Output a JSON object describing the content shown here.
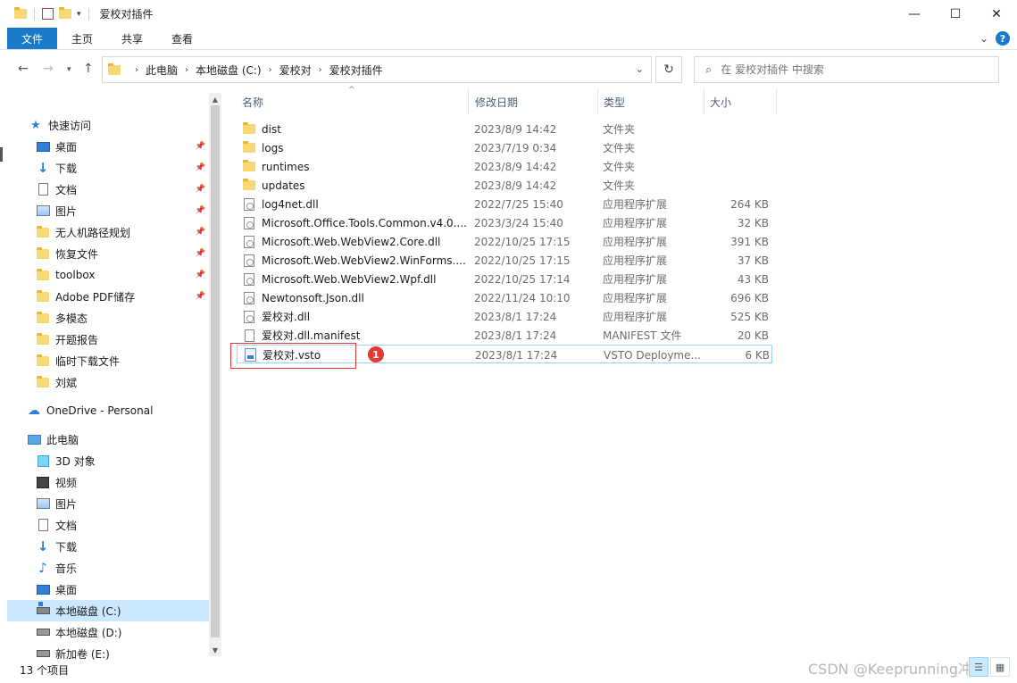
{
  "window": {
    "title": "爱校对插件",
    "controls": {
      "minimize": "—",
      "maximize": "☐",
      "close": "✕"
    }
  },
  "ribbon": {
    "tabs": [
      "文件",
      "主页",
      "共享",
      "查看"
    ],
    "expand": "⌄",
    "help": "?"
  },
  "address": {
    "crumbs": [
      "此电脑",
      "本地磁盘 (C:)",
      "爱校对",
      "爱校对插件"
    ],
    "search_placeholder": "在 爱校对插件 中搜索"
  },
  "nav": {
    "items": [
      {
        "label": "快速访问",
        "icon": "star-icon",
        "pinned": false,
        "selected": false
      },
      {
        "label": "桌面",
        "icon": "desktop-icon",
        "pinned": true,
        "selected": false
      },
      {
        "label": "下载",
        "icon": "download-icon",
        "pinned": true,
        "selected": false
      },
      {
        "label": "文档",
        "icon": "document-icon",
        "pinned": true,
        "selected": false
      },
      {
        "label": "图片",
        "icon": "picture-icon",
        "pinned": true,
        "selected": false
      },
      {
        "label": "无人机路径规划",
        "icon": "folder-icon",
        "pinned": true,
        "selected": false
      },
      {
        "label": "恢复文件",
        "icon": "folder-icon",
        "pinned": true,
        "selected": false
      },
      {
        "label": "toolbox",
        "icon": "folder-icon",
        "pinned": true,
        "selected": false
      },
      {
        "label": "Adobe PDF储存",
        "icon": "folder-icon",
        "pinned": true,
        "selected": false
      },
      {
        "label": "多模态",
        "icon": "folder-icon",
        "pinned": false,
        "selected": false
      },
      {
        "label": "开题报告",
        "icon": "folder-icon",
        "pinned": false,
        "selected": false
      },
      {
        "label": "临时下载文件",
        "icon": "folder-icon",
        "pinned": false,
        "selected": false
      },
      {
        "label": "刘斌",
        "icon": "folder-icon",
        "pinned": false,
        "selected": false
      },
      {
        "label": "OneDrive - Personal",
        "icon": "cloud-icon",
        "pinned": false,
        "selected": false
      },
      {
        "label": "此电脑",
        "icon": "computer-icon",
        "pinned": false,
        "selected": false
      },
      {
        "label": "3D 对象",
        "icon": "cube-icon",
        "pinned": false,
        "selected": false
      },
      {
        "label": "视频",
        "icon": "video-icon",
        "pinned": false,
        "selected": false
      },
      {
        "label": "图片",
        "icon": "picture-icon",
        "pinned": false,
        "selected": false
      },
      {
        "label": "文档",
        "icon": "document-icon",
        "pinned": false,
        "selected": false
      },
      {
        "label": "下载",
        "icon": "download-icon",
        "pinned": false,
        "selected": false
      },
      {
        "label": "音乐",
        "icon": "music-icon",
        "pinned": false,
        "selected": false
      },
      {
        "label": "桌面",
        "icon": "desktop-icon",
        "pinned": false,
        "selected": false
      },
      {
        "label": "本地磁盘 (C:)",
        "icon": "drive-c-icon",
        "pinned": false,
        "selected": true
      },
      {
        "label": "本地磁盘 (D:)",
        "icon": "drive-icon",
        "pinned": false,
        "selected": false
      },
      {
        "label": "新加卷 (E:)",
        "icon": "drive-icon",
        "pinned": false,
        "selected": false
      }
    ]
  },
  "columns": [
    "名称",
    "修改日期",
    "类型",
    "大小"
  ],
  "files": [
    {
      "name": "dist",
      "date": "2023/8/9 14:42",
      "type": "文件夹",
      "size": "",
      "icon": "folder"
    },
    {
      "name": "logs",
      "date": "2023/7/19 0:34",
      "type": "文件夹",
      "size": "",
      "icon": "folder"
    },
    {
      "name": "runtimes",
      "date": "2023/8/9 14:42",
      "type": "文件夹",
      "size": "",
      "icon": "folder"
    },
    {
      "name": "updates",
      "date": "2023/8/9 14:42",
      "type": "文件夹",
      "size": "",
      "icon": "folder"
    },
    {
      "name": "log4net.dll",
      "date": "2022/7/25 15:40",
      "type": "应用程序扩展",
      "size": "264 KB",
      "icon": "dll"
    },
    {
      "name": "Microsoft.Office.Tools.Common.v4.0....",
      "date": "2023/3/24 15:40",
      "type": "应用程序扩展",
      "size": "32 KB",
      "icon": "dll"
    },
    {
      "name": "Microsoft.Web.WebView2.Core.dll",
      "date": "2022/10/25 17:15",
      "type": "应用程序扩展",
      "size": "391 KB",
      "icon": "dll"
    },
    {
      "name": "Microsoft.Web.WebView2.WinForms....",
      "date": "2022/10/25 17:15",
      "type": "应用程序扩展",
      "size": "37 KB",
      "icon": "dll"
    },
    {
      "name": "Microsoft.Web.WebView2.Wpf.dll",
      "date": "2022/10/25 17:14",
      "type": "应用程序扩展",
      "size": "43 KB",
      "icon": "dll"
    },
    {
      "name": "Newtonsoft.Json.dll",
      "date": "2022/11/24 10:10",
      "type": "应用程序扩展",
      "size": "696 KB",
      "icon": "dll"
    },
    {
      "name": "爱校对.dll",
      "date": "2023/8/1 17:24",
      "type": "应用程序扩展",
      "size": "525 KB",
      "icon": "dll"
    },
    {
      "name": "爱校对.dll.manifest",
      "date": "2023/8/1 17:24",
      "type": "MANIFEST 文件",
      "size": "20 KB",
      "icon": "doc"
    },
    {
      "name": "爱校对.vsto",
      "date": "2023/8/1 17:24",
      "type": "VSTO Deployme...",
      "size": "6 KB",
      "icon": "vsto"
    }
  ],
  "annotation": {
    "badge": "1"
  },
  "status": {
    "count": "13 个项目"
  },
  "watermark": "CSDN @Keeprunning冲鸭"
}
